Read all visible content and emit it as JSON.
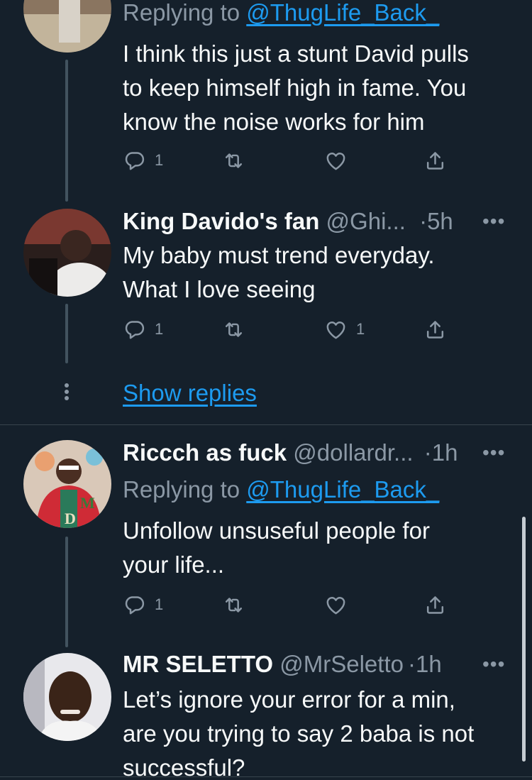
{
  "tweets": [
    {
      "replying_prefix": "Replying to ",
      "replying_to": "@ThugLife_Back_",
      "text_lines": [
        "I think this just a stunt David pulls",
        "to keep himself high in fame. You",
        "know the noise works for him"
      ],
      "reply_count": "1",
      "like_count": ""
    },
    {
      "name": "King Davido's fan",
      "handle": "@Ghi...",
      "separator": "·",
      "time": "5h",
      "text_lines": [
        "My baby must trend everyday.",
        "What I love seeing"
      ],
      "reply_count": "1",
      "like_count": "1"
    },
    {
      "name": "Riccch as fuck",
      "handle": "@dollardr...",
      "separator": "·",
      "time": "1h",
      "replying_prefix": "Replying to ",
      "replying_to": "@ThugLife_Back_",
      "text_lines": [
        "Unfollow unsuseful people for",
        "your life..."
      ],
      "reply_count": "1",
      "like_count": ""
    },
    {
      "name": "MR SELETTO",
      "handle": "@MrSeletto",
      "separator": "·",
      "time": "1h",
      "text_lines": [
        "Let’s ignore your error for a min,",
        "are you trying to say 2 baba is not",
        "successful?"
      ]
    }
  ],
  "show_replies": "Show replies",
  "more_glyph": "•••",
  "icons": {
    "reply": "reply-icon",
    "retweet": "retweet-icon",
    "like": "heart-icon",
    "share": "share-icon",
    "more": "more-icon"
  },
  "colors": {
    "background": "#15202b",
    "text": "#f7f9f9",
    "secondary": "#8b98a5",
    "link": "#1d9bf0",
    "thread_line": "#42535f"
  }
}
